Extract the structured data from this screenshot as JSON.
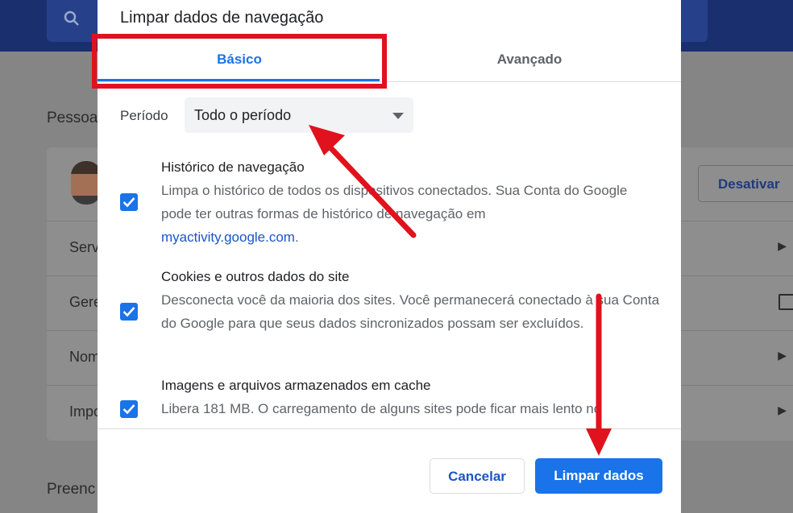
{
  "background": {
    "section_people": "Pessoa",
    "section_autofill": "Preenc",
    "disable_button": "Desativar",
    "rows": [
      {
        "label": "Serv"
      },
      {
        "label": "Gere"
      },
      {
        "label": "Nom"
      },
      {
        "label": "Impo"
      }
    ]
  },
  "dialog": {
    "title": "Limpar dados de navegação",
    "tabs": [
      {
        "label": "Básico",
        "active": true
      },
      {
        "label": "Avançado",
        "active": false
      }
    ],
    "period": {
      "label": "Período",
      "value": "Todo o período"
    },
    "items": [
      {
        "title": "Histórico de navegação",
        "description": "Limpa o histórico de todos os dispositivos conectados. Sua Conta do Google pode ter outras formas de histórico de navegação em",
        "link": "myactivity.google.com",
        "link_suffix": ".",
        "checked": true
      },
      {
        "title": "Cookies e outros dados do site",
        "description": "Desconecta você da maioria dos sites. Você permanecerá conectado à sua Conta do Google para que seus dados sincronizados possam ser excluídos.",
        "checked": true
      },
      {
        "title": "Imagens e arquivos armazenados em cache",
        "description": "Libera 181 MB. O carregamento de alguns sites pode ficar mais lento no",
        "checked": true
      }
    ],
    "buttons": {
      "cancel": "Cancelar",
      "clear": "Limpar dados"
    }
  },
  "colors": {
    "accent": "#1a73e8",
    "annotation": "#e0121d"
  }
}
